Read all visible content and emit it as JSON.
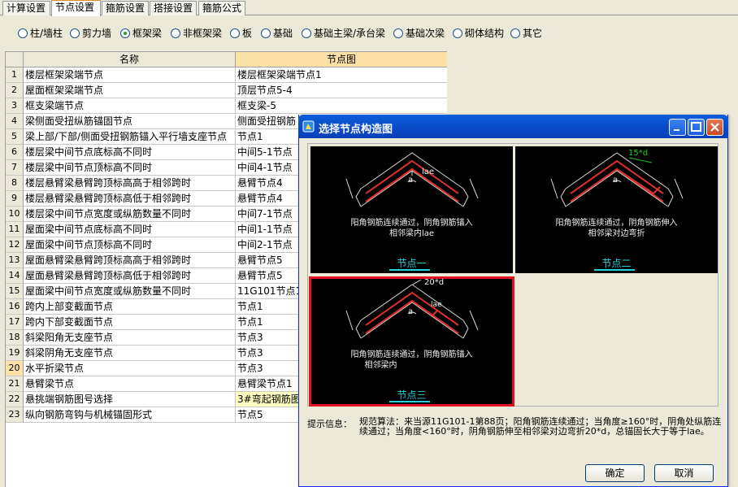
{
  "tabs": [
    "计算设置",
    "节点设置",
    "箍筋设置",
    "搭接设置",
    "箍筋公式"
  ],
  "active_tab": "节点设置",
  "radios": [
    {
      "label": "柱/墙柱",
      "checked": false
    },
    {
      "label": "剪力墙",
      "checked": false
    },
    {
      "label": "框架梁",
      "checked": true
    },
    {
      "label": "非框架梁",
      "checked": false
    },
    {
      "label": "板",
      "checked": false
    },
    {
      "label": "基础",
      "checked": false
    },
    {
      "label": "基础主梁/承台梁",
      "checked": false
    },
    {
      "label": "基础次梁",
      "checked": false
    },
    {
      "label": "砌体结构",
      "checked": false
    },
    {
      "label": "其它",
      "checked": false
    }
  ],
  "grid": {
    "headers": [
      "",
      "名称",
      "节点图"
    ],
    "rows": [
      {
        "no": "1",
        "name": "楼层框架梁端节点",
        "node": "楼层框架梁端节点1"
      },
      {
        "no": "2",
        "name": "屋面框架梁端节点",
        "node": "顶层节点5-4"
      },
      {
        "no": "3",
        "name": "框支梁端节点",
        "node": "框支梁-5"
      },
      {
        "no": "4",
        "name": "梁侧面受扭纵筋锚固节点",
        "node": "侧面受扭钢筋"
      },
      {
        "no": "5",
        "name": "梁上部/下部/侧面受扭钢筋锚入平行墙支座节点",
        "node": "节点1"
      },
      {
        "no": "6",
        "name": "楼层梁中间节点底标高不同时",
        "node": "中间5-1节点"
      },
      {
        "no": "7",
        "name": "楼层梁中间节点顶标高不同时",
        "node": "中间4-1节点"
      },
      {
        "no": "8",
        "name": "楼层悬臂梁悬臂跨顶标高高于相邻跨时",
        "node": "悬臂节点4"
      },
      {
        "no": "9",
        "name": "楼层悬臂梁悬臂跨顶标高低于相邻跨时",
        "node": "悬臂节点4"
      },
      {
        "no": "10",
        "name": "楼层梁中间节点宽度或纵筋数量不同时",
        "node": "中间7-1节点"
      },
      {
        "no": "11",
        "name": "屋面梁中间节点底标高不同时",
        "node": "中间1-1节点"
      },
      {
        "no": "12",
        "name": "屋面梁中间节点顶标高不同时",
        "node": "中间2-1节点"
      },
      {
        "no": "13",
        "name": "屋面悬臂梁悬臂跨顶标高高于相邻跨时",
        "node": "悬臂节点5"
      },
      {
        "no": "14",
        "name": "屋面悬臂梁悬臂跨顶标高低于相邻跨时",
        "node": "悬臂节点5"
      },
      {
        "no": "15",
        "name": "屋面梁中间节点宽度或纵筋数量不同时",
        "node": "11G101节点1"
      },
      {
        "no": "16",
        "name": "跨内上部变截面节点",
        "node": "节点1"
      },
      {
        "no": "17",
        "name": "跨内下部变截面节点",
        "node": "节点1"
      },
      {
        "no": "18",
        "name": "斜梁阳角无支座节点",
        "node": "节点3"
      },
      {
        "no": "19",
        "name": "斜梁阴角无支座节点",
        "node": "节点3"
      },
      {
        "no": "20",
        "name": "水平折梁节点",
        "node": "节点3"
      },
      {
        "no": "21",
        "name": "悬臂梁节点",
        "node": "悬臂梁节点1"
      },
      {
        "no": "22",
        "name": "悬挑端钢筋图号选择",
        "node": "3#弯起钢筋图"
      },
      {
        "no": "23",
        "name": "纵向钢筋弯钩与机械锚固形式",
        "node": "节点5"
      }
    ],
    "highlighted_row": "20",
    "selected_value_row": "22"
  },
  "dialog": {
    "title": "选择节点构造图",
    "cards": [
      {
        "label": "节点一",
        "desc1": "阳角钢筋连续通过，阴角钢筋锚入",
        "desc2": "相邻梁内lae",
        "dim": "lae",
        "angle": "a",
        "selected": false
      },
      {
        "label": "节点二",
        "desc1": "阳角钢筋连续通过，阴角钢筋伸入",
        "desc2": "相邻梁对边弯折",
        "dim": "15*d",
        "angle": "a",
        "selected": false
      },
      {
        "label": "节点三",
        "desc1": "阳角钢筋连续通过，阴角钢筋锚入",
        "desc2": "相邻梁内",
        "dim": "20*d",
        "dim2": "lae",
        "angle": "a",
        "selected": true
      }
    ],
    "hint_label": "提示信息：",
    "hint_text": "规范算法：来当源11G101-1第88页；阳角钢筋连续通过；当角度≥160°时，阴角处纵筋连续通过；当角度<160°时，阴角钢筋伸至相邻梁对边弯折20*d，总锚固长大于等于lae。",
    "ok_label": "确定",
    "cancel_label": "取消"
  },
  "colors": {
    "accent_tab": "#e68b2c",
    "grid_header_highlight": "#fbe0a8",
    "selected_cell": "#ffffc2",
    "card_caption": "#2ad0d8",
    "card_selected_border": "#e0121b",
    "title_bar": "#0a49c8"
  }
}
